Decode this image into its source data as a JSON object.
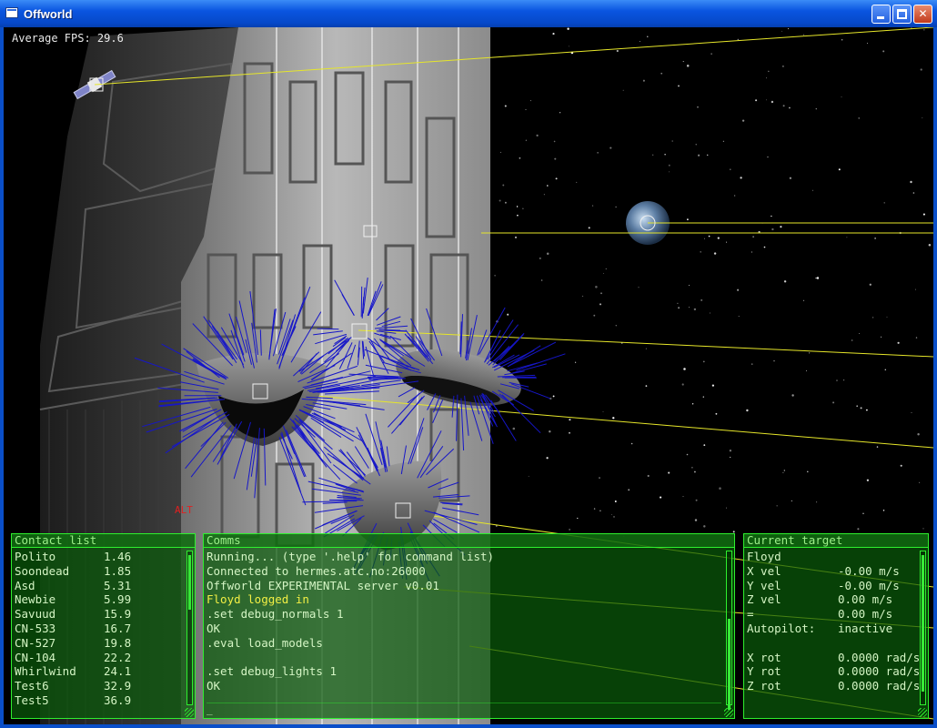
{
  "window": {
    "title": "Offworld"
  },
  "hud": {
    "fps_text": "Average FPS: 29.6",
    "alt_label": "ALT"
  },
  "contacts": {
    "title": "Contact list",
    "items": [
      {
        "name": "Polito",
        "dist": "1.46"
      },
      {
        "name": "Soondead",
        "dist": "1.85"
      },
      {
        "name": "Asd",
        "dist": "5.31"
      },
      {
        "name": "Newbie",
        "dist": "5.99"
      },
      {
        "name": "Savuud",
        "dist": "15.9"
      },
      {
        "name": "CN-533",
        "dist": "16.7"
      },
      {
        "name": "CN-527",
        "dist": "19.8"
      },
      {
        "name": "CN-104",
        "dist": "22.2"
      },
      {
        "name": "Whirlwind",
        "dist": "24.1"
      },
      {
        "name": "Test6",
        "dist": "32.9"
      },
      {
        "name": "Test5",
        "dist": "36.9"
      }
    ]
  },
  "comms": {
    "title": "Comms",
    "lines": [
      {
        "text": "Running... (type '.help' for command list)",
        "highlight": false
      },
      {
        "text": "Connected to hermes.atc.no:26000",
        "highlight": false
      },
      {
        "text": "Offworld EXPERIMENTAL server v0.01",
        "highlight": false
      },
      {
        "text": "Floyd logged in",
        "highlight": true
      },
      {
        "text": ".set debug_normals 1",
        "highlight": false
      },
      {
        "text": "OK",
        "highlight": false
      },
      {
        "text": ".eval load_models",
        "highlight": false
      },
      {
        "text": "",
        "highlight": false
      },
      {
        "text": ".set debug_lights 1",
        "highlight": false
      },
      {
        "text": "OK",
        "highlight": false
      }
    ],
    "input_value": "_"
  },
  "target": {
    "title": "Current target",
    "name": "Floyd",
    "rows": [
      {
        "label": "X vel",
        "value": "-0.00 m/s"
      },
      {
        "label": "Y vel",
        "value": "-0.00 m/s"
      },
      {
        "label": "Z vel",
        "value": "0.00 m/s"
      },
      {
        "label": "=",
        "value": "0.00 m/s"
      },
      {
        "label": "Autopilot:",
        "value": "inactive"
      },
      {
        "label": "",
        "value": ""
      },
      {
        "label": "X rot",
        "value": "0.0000 rad/s"
      },
      {
        "label": "Y rot",
        "value": "0.0000 rad/s"
      },
      {
        "label": "Z rot",
        "value": "0.0000 rad/s"
      }
    ]
  },
  "colors": {
    "hud_green": "#2ef02e",
    "hud_text": "#d4f5c4",
    "highlight_yellow": "#f2ef44",
    "alt_red": "#e02020",
    "beam_yellow": "#e6e62a",
    "normals_blue": "#1616c8"
  }
}
